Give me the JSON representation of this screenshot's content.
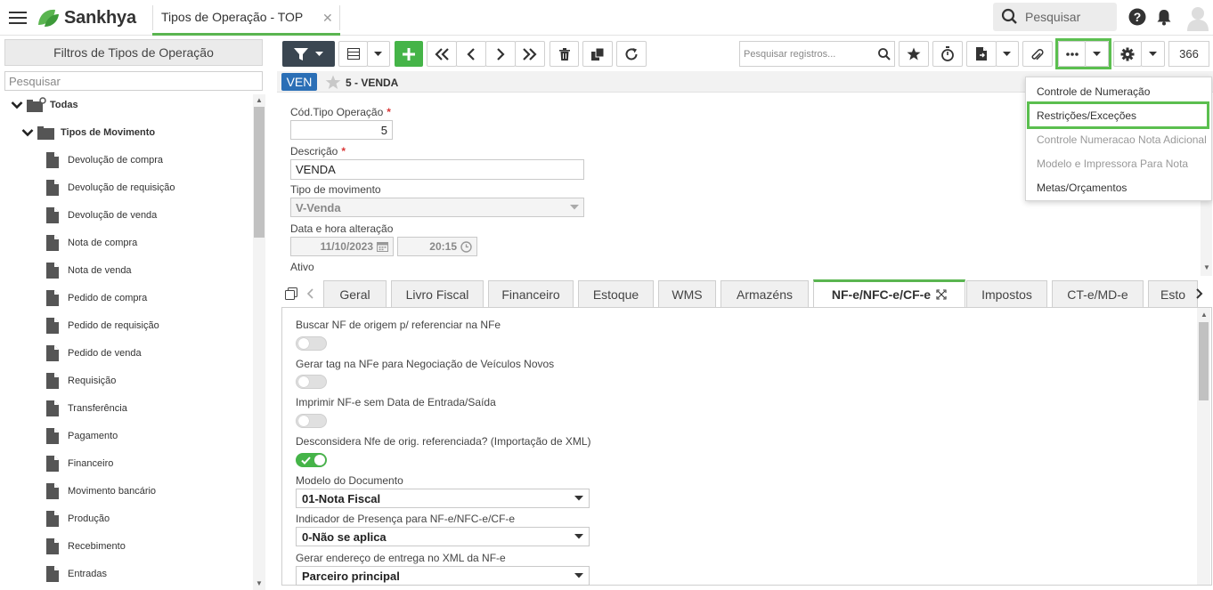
{
  "header": {
    "brand": "Sankhya",
    "tab_title": "Tipos de Operação - TOP",
    "tab_close": "✕",
    "search_placeholder": "Pesquisar",
    "accent_color": "#5ab550"
  },
  "sidebar": {
    "filter_button": "Filtros de Tipos de Operação",
    "search_placeholder": "Pesquisar",
    "root": "Todas",
    "group": "Tipos de Movimento",
    "items": [
      "Devolução de compra",
      "Devolução de requisição",
      "Devolução de venda",
      "Nota de compra",
      "Nota de venda",
      "Pedido de compra",
      "Pedido de requisição",
      "Pedido de venda",
      "Requisição",
      "Transferência",
      "Pagamento",
      "Financeiro",
      "Movimento bancário",
      "Produção",
      "Recebimento",
      "Entradas"
    ]
  },
  "toolbar": {
    "record_search_placeholder": "Pesquisar registros...",
    "record_count": "366"
  },
  "record": {
    "badge": "VEN",
    "title": "5 - VENDA"
  },
  "form": {
    "cod_label": "Cód.Tipo Operação",
    "cod_value": "5",
    "desc_label": "Descrição",
    "desc_value": "VENDA",
    "tipo_label": "Tipo de movimento",
    "tipo_value": "V-Venda",
    "data_label": "Data e hora alteração",
    "data_value": "11/10/2023",
    "hora_value": "20:15",
    "ativo_label": "Ativo",
    "required_mark": "*"
  },
  "tabs": [
    "Geral",
    "Livro Fiscal",
    "Financeiro",
    "Estoque",
    "WMS",
    "Armazéns",
    "NF-e/NFC-e/CF-e",
    "Impostos",
    "CT-e/MD-e",
    "Esto"
  ],
  "active_tab": "NF-e/NFC-e/CF-e",
  "panel": {
    "toggle1_label": "Buscar NF de origem p/ referenciar na NFe",
    "toggle2_label": "Gerar tag na NFe para Negociação de Veículos Novos",
    "toggle3_label": "Imprimir NF-e sem Data de Entrada/Saída",
    "toggle4_label": "Desconsidera Nfe de orig. referenciada? (Importação de XML)",
    "modelo_label": "Modelo do Documento",
    "modelo_value": "01-Nota Fiscal",
    "presenca_label": "Indicador de Presença para NF-e/NFC-e/CF-e",
    "presenca_value": "0-Não se aplica",
    "endereco_label": "Gerar endereço de entrega no XML da NF-e",
    "endereco_value": "Parceiro principal"
  },
  "more_menu": {
    "items": [
      "Controle de Numeração",
      "Restrições/Exceções",
      "Controle Numeracao Nota Adicional",
      "Modelo e Impressora Para Nota",
      "Metas/Orçamentos"
    ]
  }
}
